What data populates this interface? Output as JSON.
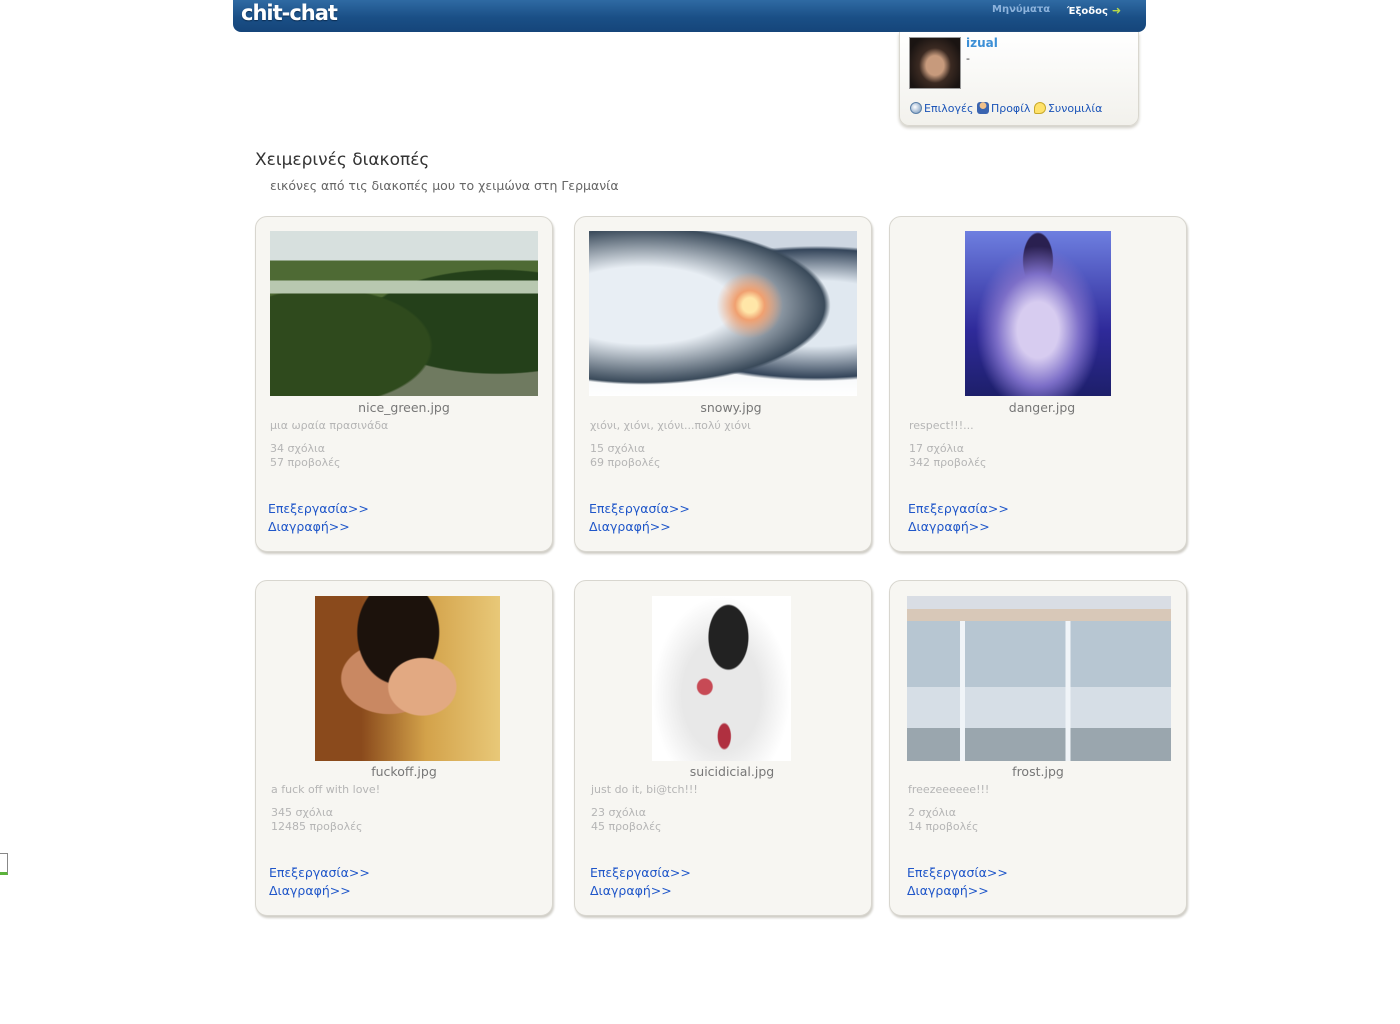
{
  "header": {
    "logo": "chit-chat",
    "messages_label": "Μηνύματα",
    "logout_label": "Έξοδος"
  },
  "user": {
    "name": "izual",
    "status": "-",
    "links": {
      "options": "Επιλογές",
      "profile": "Προφίλ",
      "chat": "Συνομιλία"
    }
  },
  "album": {
    "title": "Χειμερινές διακοπές",
    "description": "εικόνες από τις διακοπές μου το χειμώνα στη Γερμανία"
  },
  "photos": [
    {
      "filename": "nice_green.jpg",
      "caption": "μια ωραία πρασινάδα",
      "comments": "34 σχόλια",
      "views": "57 προβολές",
      "edit": "Επεξεργασία>>",
      "delete": "Διαγραφή>>"
    },
    {
      "filename": "snowy.jpg",
      "caption": "χιόνι, χιόνι, χιόνι...πολύ χιόνι",
      "comments": "15 σχόλια",
      "views": "69 προβολές",
      "edit": "Επεξεργασία>>",
      "delete": "Διαγραφή>>"
    },
    {
      "filename": "danger.jpg",
      "caption": "respect!!!...",
      "comments": "17 σχόλια",
      "views": "342 προβολές",
      "edit": "Επεξεργασία>>",
      "delete": "Διαγραφή>>"
    },
    {
      "filename": "fuckoff.jpg",
      "caption": "a fuck off with love!",
      "comments": "345 σχόλια",
      "views": "12485 προβολές",
      "edit": "Επεξεργασία>>",
      "delete": "Διαγραφή>>"
    },
    {
      "filename": "suicidicial.jpg",
      "caption": "just do it, bi@tch!!!",
      "comments": "23 σχόλια",
      "views": "45 προβολές",
      "edit": "Επεξεργασία>>",
      "delete": "Διαγραφή>>"
    },
    {
      "filename": "frost.jpg",
      "caption": "freezeeeeee!!!",
      "comments": "2 σχόλια",
      "views": "14 προβολές",
      "edit": "Επεξεργασία>>",
      "delete": "Διαγραφή>>"
    }
  ]
}
